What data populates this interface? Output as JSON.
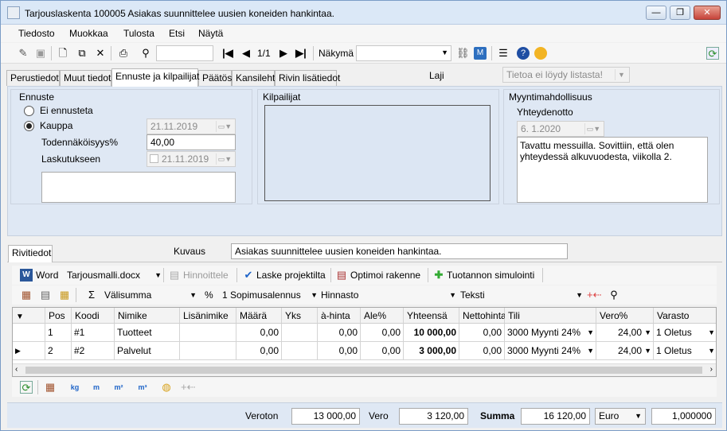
{
  "window": {
    "title": "Tarjouslaskenta 100005 Asiakas suunnittelee uusien koneiden hankintaa.",
    "min": "—",
    "max": "❐",
    "close": "✕"
  },
  "menu": [
    "Tiedosto",
    "Muokkaa",
    "Tulosta",
    "Etsi",
    "Näytä"
  ],
  "toolbar": {
    "page": "1/1",
    "view_label": "Näkymä"
  },
  "tabs": [
    "Perustiedot",
    "Muut tiedot",
    "Ennuste ja kilpailijat",
    "Päätös",
    "Kansilehti",
    "Rivin lisätiedot"
  ],
  "laji": {
    "label": "Laji",
    "placeholder": "Tietoa ei löydy listasta!"
  },
  "ennuste": {
    "title": "Ennuste",
    "radio_no": "Ei ennusteta",
    "radio_trade": "Kauppa",
    "trade_date": "21.11.2019",
    "probability_label": "Todennäköisyys%",
    "probability": "40,00",
    "invoicing_label": "Laskutukseen",
    "invoicing_date": "21.11.2019"
  },
  "kilpailijat": {
    "title": "Kilpailijat"
  },
  "myynti": {
    "title": "Myyntimahdollisuus",
    "contact_label": "Yhteydenotto",
    "contact_date": "6.  1.2020",
    "note": "Tavattu messuilla. Sovittiin, että olen yhteydessä alkuvuodesta, viikolla 2."
  },
  "rivitiedot": {
    "tab": "Rivitiedot",
    "kuvaus_label": "Kuvaus",
    "kuvaus": "Asiakas suunnittelee uusien koneiden hankintaa."
  },
  "rowtoolbar": {
    "word": "Word",
    "template": "Tarjousmalli.docx",
    "hinnoittele": "Hinnoittele",
    "laske": "Laske projektilta",
    "optimoi": "Optimoi rakenne",
    "tuotanto": "Tuotannon simulointi"
  },
  "rowtoolbar2": {
    "valisumma": "Välisumma",
    "percent": "%",
    "sopimus": "1 Sopimusalennus",
    "hinnasto": "Hinnasto",
    "teksti": "Teksti"
  },
  "grid": {
    "headers": [
      "Pos",
      "Koodi",
      "Nimike",
      "Lisänimike",
      "Määrä",
      "Yks",
      "à-hinta",
      "Ale%",
      "Yhteensä",
      "Nettohinta",
      "Tili",
      "Vero%",
      "Varasto"
    ],
    "rows": [
      {
        "pos": "1",
        "koodi": "#1",
        "nimike": "Tuotteet",
        "lisanimike": "",
        "maara": "0,00",
        "yks": "",
        "ahinta": "0,00",
        "ale": "0,00",
        "yhteensa": "10 000,00",
        "netto": "0,00",
        "tili": "3000 Myynti 24%",
        "vero": "24,00",
        "varasto": "1 Oletus"
      },
      {
        "pos": "2",
        "koodi": "#2",
        "nimike": "Palvelut",
        "lisanimike": "",
        "maara": "0,00",
        "yks": "",
        "ahinta": "0,00",
        "ale": "0,00",
        "yhteensa": "3 000,00",
        "netto": "0,00",
        "tili": "3000 Myynti 24%",
        "vero": "24,00",
        "varasto": "1 Oletus"
      }
    ]
  },
  "unitbar": [
    "kg",
    "m",
    "m²",
    "m³"
  ],
  "totals": {
    "veroton_label": "Veroton",
    "veroton": "13 000,00",
    "vero_label": "Vero",
    "vero": "3 120,00",
    "summa_label": "Summa",
    "summa": "16 120,00",
    "currency": "Euro",
    "rate": "1,000000"
  }
}
